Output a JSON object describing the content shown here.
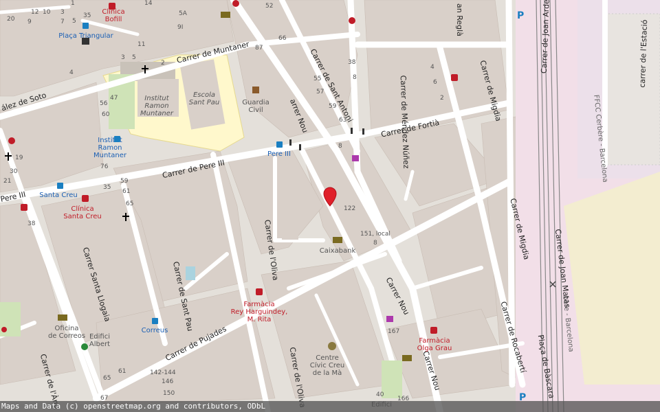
{
  "streets": {
    "muntaner": "Carrer de Muntaner",
    "soto": "ález de Soto",
    "sant_antoni": "Carrer de Sant Antoni",
    "mendez_nunez": "Carrer de Méndez Núñez",
    "regla": "an Reglà",
    "joan_arderius": "Carrer de Joan Arderius",
    "estacio": "carrer de l'Estació",
    "migdia_top": "Carrer de Migdia",
    "fortia": "Carrer de Fortià",
    "pere_iii_main": "Carrer de Pere III",
    "pere_iii_left": "Pere III",
    "nou_top": "arrer Nou",
    "oliva_top": "Carrer de l'Oliva",
    "migdia_mid": "Carrer de Migdia",
    "joan_matas": "Carrer de Joan Matas",
    "santa_llogaia": "Carrer Santa Llogaia",
    "sant_pau": "Carrer de Sant Pau",
    "nou_mid": "Carrer Nou",
    "rocaberti": "Carrer de Rocabertí",
    "pujades": "Carrer de Pujades",
    "oliva_bottom": "Carrer de l'Oliva",
    "nou_bottom": "Carrer Nou",
    "bascara": "Plaça de Bàscara",
    "angels": "Carrer de l'Àng",
    "rail_top": "FFCC Cerbère - Barcelona",
    "rail_bottom": "bère - Barcelona"
  },
  "pois": {
    "clinica_bofill": "Clínica\nBofill",
    "placa_triangular": "Plaça Triangular",
    "institut_ramon_muntaner_school": "Institut\nRamon\nMuntaner",
    "escola_sant_pau": "Escola\nSant Pau",
    "guardia_civil": "Guardia\nCivil",
    "institut_ramon_muntaner_bus": "Institut\nRamon\nMuntaner",
    "pere_iii_bus": "Pere III",
    "santa_creu_bus": "Santa Creu",
    "clinica_santa_creu": "Clínica\nSanta Creu",
    "caixabank": "Caixabank",
    "farmacia_rey": "Farmàcia\nRey Harguindey,\nM. Rita",
    "correus": "Correus",
    "oficina_correos": "Oficina\nde Correos",
    "edifici_albert": "Edifici\nAlbert",
    "centre_civic": "Centre\nCívic Creu\nde la Mà",
    "farmacia_olga": "Farmàcia\nOlga Grau",
    "edifici_bottom": "Edifici"
  },
  "housenumbers": {
    "n20": "20",
    "n12": "12",
    "n10": "10",
    "n3": "3",
    "n1": "1",
    "n35a": "35",
    "n9a": "9",
    "n7": "7",
    "n5": "5",
    "n14": "14",
    "n5A": "5A",
    "n9I": "9I",
    "n11": "11",
    "n2": "2",
    "n3b": "3",
    "n5b": "5",
    "n87": "87",
    "n52": "52",
    "n66": "66",
    "n4a": "4",
    "n56": "56",
    "n60": "60",
    "n47": "47",
    "n55": "55",
    "n57": "57",
    "n59": "59",
    "n63": "63",
    "n38a": "38",
    "n8a": "8",
    "n4b": "4",
    "n6": "6",
    "n2b": "2",
    "n76": "76",
    "n19": "19",
    "n30": "30",
    "n21": "21",
    "n59b": "59",
    "n61": "61",
    "n65": "65",
    "n35b": "35",
    "n38b": "38",
    "n8b": "8",
    "n122": "122",
    "n151": "151, local",
    "n8c": "8",
    "n167": "167",
    "n65b": "65",
    "n61b": "61",
    "n142": "142-144",
    "n146": "146",
    "n150": "150",
    "n67": "67",
    "n40": "40",
    "n166": "166"
  },
  "markers": {
    "location_pin_color": "#e0202a"
  },
  "colors": {
    "background": "#f2efe9",
    "building": "#d9d0c9",
    "road": "#ffffff",
    "school": "#fff8cc",
    "railway_area": "#f2dfe8",
    "park": "#f3edd0",
    "bus": "#1a7fc1",
    "health": "#c01c28"
  },
  "attribution": "Maps and Data (c) openstreetmap.org and contributors, ODbL"
}
